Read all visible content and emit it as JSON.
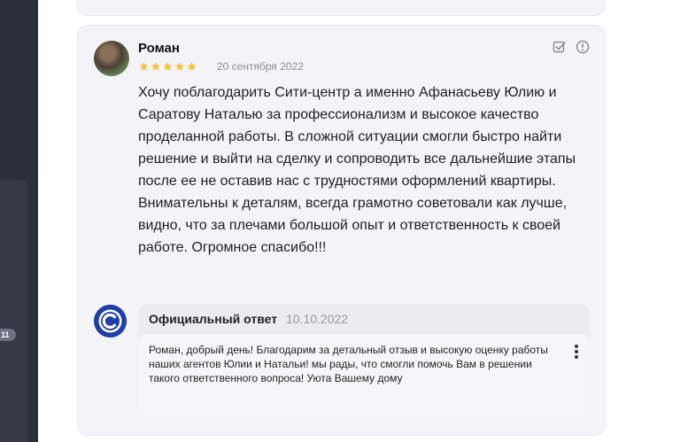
{
  "sidebar": {
    "badge_count": "11"
  },
  "review": {
    "author": "Роман",
    "rating": 5,
    "stars": [
      "★",
      "★",
      "★",
      "★",
      "★"
    ],
    "date": "20 сентября 2022",
    "text": "Хочу поблагодарить Сити-центр а именно Афанасьеву Юлию и Саратову Наталью за профессионализм и высокое качество проделанной работы. В сложной ситуации смогли быстро найти решение и выйти на сделку и сопроводить все дальнейшие этапы после ее не оставив нас с трудностями оформлений квартиры. Внимательны к деталям, всегда грамотно советовали как лучше, видно, что за плечами большой опыт и ответственность к своей работе. Огромное спасибо!!!",
    "icons": [
      "checkbox-edit-icon",
      "report-icon"
    ]
  },
  "reply": {
    "title": "Официальный ответ",
    "date": "10.10.2022",
    "text": "Роман, добрый день! Благодарим за детальный отзыв и высокую оценку работы наших агентов Юлии и Натальи! мы рады, что смогли помочь Вам в решении такого ответственного вопроса! Уюта Вашему дому",
    "logo_icon": "company-c-logo-icon",
    "menu_icon": "more-vertical-icon"
  },
  "colors": {
    "star": "#fcbc2b",
    "card_bg": "#f4f4f8",
    "rail": "#2c2f3a",
    "logo": "#1f3fa6"
  }
}
